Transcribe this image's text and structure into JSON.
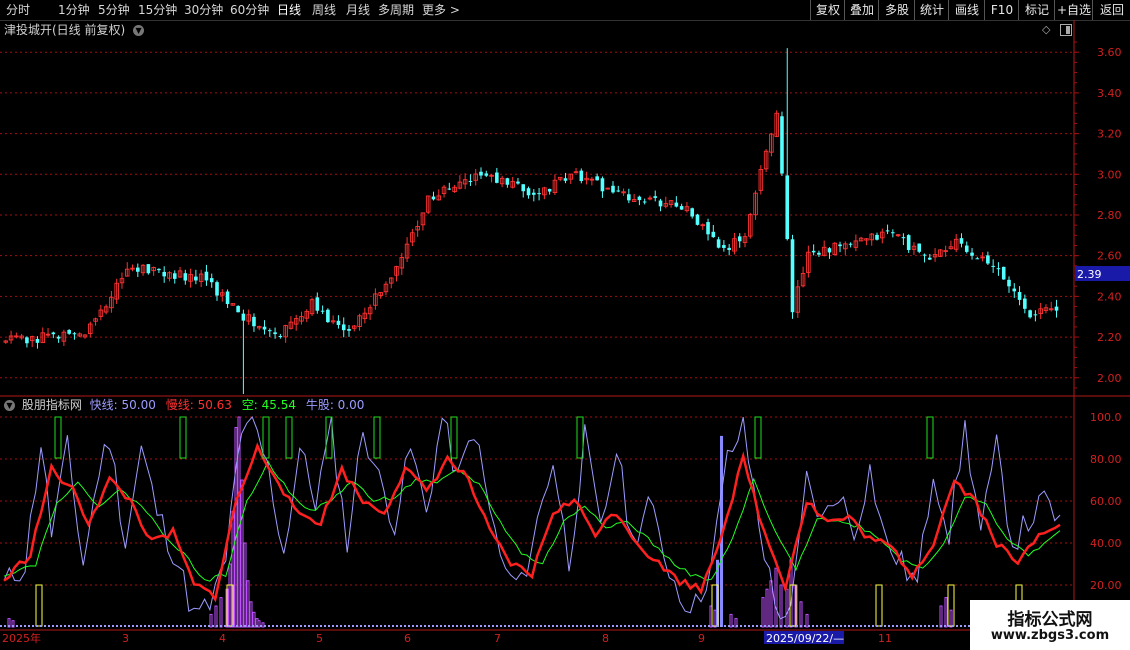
{
  "toolbar": {
    "periods": [
      "分时",
      "1分钟",
      "5分钟",
      "15分钟",
      "30分钟",
      "60分钟",
      "日线",
      "周线",
      "月线",
      "多周期",
      "更多"
    ],
    "active_period": "日线",
    "right_buttons": [
      "复权",
      "叠加",
      "多股",
      "统计",
      "画线",
      "F10",
      "标记",
      "+自选",
      "返回"
    ]
  },
  "chart_header": {
    "title": "津投城开(日线 前复权)"
  },
  "indicator": {
    "name": "股朋指标网",
    "fast_label": "快线: 50.00",
    "slow_label": "慢线: 50.63",
    "empty_label": "空: 45.54",
    "bull_label": "牛股: 0.00"
  },
  "price_axis": {
    "ticks": [
      "3.60",
      "3.40",
      "3.20",
      "3.00",
      "2.80",
      "2.60",
      "2.40",
      "2.20",
      "2.00"
    ],
    "current_price": "2.39"
  },
  "indicator_axis": {
    "ticks": [
      "100.0",
      "80.00",
      "60.00",
      "40.00",
      "20.00"
    ]
  },
  "date_axis": {
    "labels": [
      "2025年",
      "3",
      "4",
      "5",
      "6",
      "7",
      "8",
      "9",
      "11"
    ],
    "cursor_date": "2025/09/22/—"
  },
  "watermark": {
    "line1": "指标公式网",
    "line2": "www.zbgs3.com"
  },
  "colors": {
    "up": "#ff3232",
    "down": "#54ffff",
    "fast": "#9c9cff",
    "slow": "#ff2020",
    "empty": "#20ff20",
    "bull": "#c050ff",
    "grid": "#a01010"
  },
  "chart_data": [
    {
      "type": "candlestick",
      "title": "津投城开(日线 前复权)",
      "y_range": [
        1.93,
        3.66
      ],
      "current_price": 2.39,
      "key_prices": {
        "first_close": 2.18,
        "low_april": 1.92,
        "high_october": 3.62,
        "last_close": 2.33
      },
      "control_points": [
        [
          0,
          2.18
        ],
        [
          15,
          2.22
        ],
        [
          24,
          2.55
        ],
        [
          38,
          2.48
        ],
        [
          45,
          2.3
        ],
        [
          52,
          2.22
        ],
        [
          58,
          2.36
        ],
        [
          64,
          2.22
        ],
        [
          73,
          2.48
        ],
        [
          80,
          2.88
        ],
        [
          90,
          3.0
        ],
        [
          100,
          2.9
        ],
        [
          108,
          3.0
        ],
        [
          118,
          2.88
        ],
        [
          128,
          2.85
        ],
        [
          136,
          2.62
        ],
        [
          140,
          2.7
        ],
        [
          146,
          3.32
        ],
        [
          149,
          2.34
        ],
        [
          152,
          2.62
        ],
        [
          160,
          2.65
        ],
        [
          168,
          2.72
        ],
        [
          174,
          2.58
        ],
        [
          180,
          2.66
        ],
        [
          188,
          2.52
        ],
        [
          194,
          2.32
        ],
        [
          200,
          2.34
        ]
      ]
    },
    {
      "type": "line",
      "title": "股朋指标网",
      "y_range": [
        0,
        100
      ],
      "series": [
        {
          "name": "快线",
          "value": 50.0,
          "control_points": [
            [
              0,
              20
            ],
            [
              4,
              30
            ],
            [
              7,
              88
            ],
            [
              9,
              45
            ],
            [
              12,
              85
            ],
            [
              15,
              30
            ],
            [
              18,
              75
            ],
            [
              20,
              90
            ],
            [
              23,
              40
            ],
            [
              26,
              85
            ],
            [
              29,
              55
            ],
            [
              33,
              30
            ],
            [
              36,
              5
            ],
            [
              39,
              10
            ],
            [
              42,
              30
            ],
            [
              44,
              80
            ],
            [
              47,
              100
            ],
            [
              50,
              75
            ],
            [
              53,
              35
            ],
            [
              56,
              85
            ],
            [
              59,
              60
            ],
            [
              62,
              95
            ],
            [
              65,
              40
            ],
            [
              68,
              95
            ],
            [
              71,
              70
            ],
            [
              74,
              50
            ],
            [
              77,
              85
            ],
            [
              80,
              55
            ],
            [
              83,
              100
            ],
            [
              86,
              70
            ],
            [
              89,
              95
            ],
            [
              92,
              55
            ],
            [
              95,
              25
            ],
            [
              98,
              20
            ],
            [
              101,
              50
            ],
            [
              104,
              80
            ],
            [
              107,
              30
            ],
            [
              110,
              90
            ],
            [
              113,
              45
            ],
            [
              116,
              85
            ],
            [
              119,
              40
            ],
            [
              122,
              60
            ],
            [
              125,
              35
            ],
            [
              128,
              15
            ],
            [
              131,
              10
            ],
            [
              134,
              30
            ],
            [
              137,
              80
            ],
            [
              140,
              95
            ],
            [
              143,
              50
            ],
            [
              146,
              10
            ],
            [
              149,
              5
            ],
            [
              152,
              70
            ],
            [
              155,
              50
            ],
            [
              158,
              65
            ],
            [
              161,
              45
            ],
            [
              164,
              75
            ],
            [
              167,
              40
            ],
            [
              170,
              30
            ],
            [
              173,
              20
            ],
            [
              176,
              75
            ],
            [
              179,
              45
            ],
            [
              182,
              95
            ],
            [
              185,
              45
            ],
            [
              188,
              85
            ],
            [
              191,
              40
            ],
            [
              194,
              50
            ],
            [
              197,
              60
            ],
            [
              200,
              50
            ]
          ]
        },
        {
          "name": "慢线",
          "value": 50.63,
          "control_points": [
            [
              0,
              22
            ],
            [
              5,
              35
            ],
            [
              9,
              75
            ],
            [
              13,
              65
            ],
            [
              16,
              50
            ],
            [
              20,
              70
            ],
            [
              24,
              60
            ],
            [
              28,
              40
            ],
            [
              32,
              45
            ],
            [
              36,
              20
            ],
            [
              40,
              15
            ],
            [
              44,
              60
            ],
            [
              48,
              85
            ],
            [
              52,
              70
            ],
            [
              55,
              55
            ],
            [
              60,
              50
            ],
            [
              64,
              75
            ],
            [
              68,
              60
            ],
            [
              72,
              55
            ],
            [
              76,
              75
            ],
            [
              80,
              65
            ],
            [
              84,
              80
            ],
            [
              88,
              70
            ],
            [
              92,
              45
            ],
            [
              96,
              30
            ],
            [
              100,
              25
            ],
            [
              104,
              55
            ],
            [
              108,
              60
            ],
            [
              112,
              45
            ],
            [
              116,
              55
            ],
            [
              120,
              40
            ],
            [
              124,
              30
            ],
            [
              128,
              22
            ],
            [
              132,
              18
            ],
            [
              136,
              45
            ],
            [
              140,
              80
            ],
            [
              144,
              45
            ],
            [
              148,
              20
            ],
            [
              152,
              60
            ],
            [
              156,
              50
            ],
            [
              160,
              52
            ],
            [
              164,
              42
            ],
            [
              168,
              38
            ],
            [
              172,
              25
            ],
            [
              176,
              40
            ],
            [
              180,
              70
            ],
            [
              184,
              60
            ],
            [
              188,
              40
            ],
            [
              192,
              30
            ],
            [
              196,
              45
            ],
            [
              200,
              50
            ]
          ]
        },
        {
          "name": "空",
          "value": 45.54,
          "control_points": [
            [
              0,
              25
            ],
            [
              6,
              30
            ],
            [
              10,
              60
            ],
            [
              14,
              68
            ],
            [
              18,
              58
            ],
            [
              22,
              65
            ],
            [
              26,
              58
            ],
            [
              30,
              45
            ],
            [
              34,
              35
            ],
            [
              38,
              22
            ],
            [
              42,
              25
            ],
            [
              46,
              60
            ],
            [
              50,
              78
            ],
            [
              54,
              65
            ],
            [
              58,
              55
            ],
            [
              62,
              60
            ],
            [
              66,
              70
            ],
            [
              70,
              60
            ],
            [
              74,
              62
            ],
            [
              78,
              70
            ],
            [
              82,
              68
            ],
            [
              86,
              75
            ],
            [
              90,
              68
            ],
            [
              94,
              50
            ],
            [
              98,
              35
            ],
            [
              102,
              30
            ],
            [
              106,
              50
            ],
            [
              110,
              58
            ],
            [
              114,
              48
            ],
            [
              118,
              50
            ],
            [
              122,
              42
            ],
            [
              126,
              32
            ],
            [
              130,
              25
            ],
            [
              134,
              22
            ],
            [
              138,
              42
            ],
            [
              142,
              70
            ],
            [
              146,
              45
            ],
            [
              150,
              28
            ],
            [
              154,
              52
            ],
            [
              158,
              50
            ],
            [
              162,
              48
            ],
            [
              166,
              42
            ],
            [
              170,
              32
            ],
            [
              174,
              28
            ],
            [
              178,
              40
            ],
            [
              182,
              62
            ],
            [
              186,
              58
            ],
            [
              190,
              42
            ],
            [
              194,
              34
            ],
            [
              198,
              42
            ],
            [
              200,
              45
            ]
          ]
        },
        {
          "name": "牛股",
          "value": 0.0
        }
      ]
    }
  ]
}
